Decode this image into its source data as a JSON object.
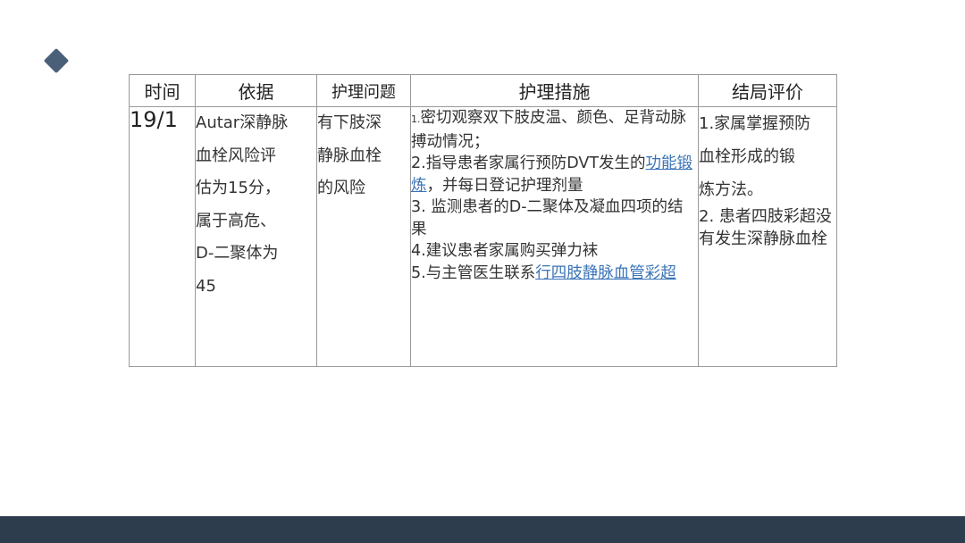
{
  "colors": {
    "accent": "#4a6078",
    "footer": "#2e3d4d",
    "link": "#3b74b7",
    "border": "#999999"
  },
  "table": {
    "headers": [
      "时间",
      "依据",
      "护理问题",
      "护理措施",
      "结局评价"
    ],
    "row": {
      "time": "19/1",
      "basis_lines": [
        "Autar深静脉",
        "血栓风险评",
        "估为15分，",
        "属于高危、",
        "D-二聚体为",
        "45"
      ],
      "problem_lines": [
        "有下肢深",
        "静脉血栓",
        "的风险"
      ],
      "measures": {
        "item1_num": "1.",
        "item1_text": "密切观察双下肢皮温、颜色、足背动脉搏动情况；",
        "item2_text": "2.指导患者家属行预防DVT发生的",
        "item2_link": "功能锻炼",
        "item2_rest": "，并每日登记护理剂量",
        "item3_text": "3. 监测患者的D-二聚体及凝血四项的结果",
        "item4_text": "4.建议患者家属购买弹力袜",
        "item5_text": "5.与主管医生联系",
        "item5_link": "行四肢静脉血管彩超"
      },
      "evaluation": {
        "item1_lines": [
          "1.家属掌握预防",
          "血栓形成的锻",
          "炼方法。"
        ],
        "item2_text": "2. 患者四肢彩超没有发生深静脉血栓"
      }
    }
  }
}
